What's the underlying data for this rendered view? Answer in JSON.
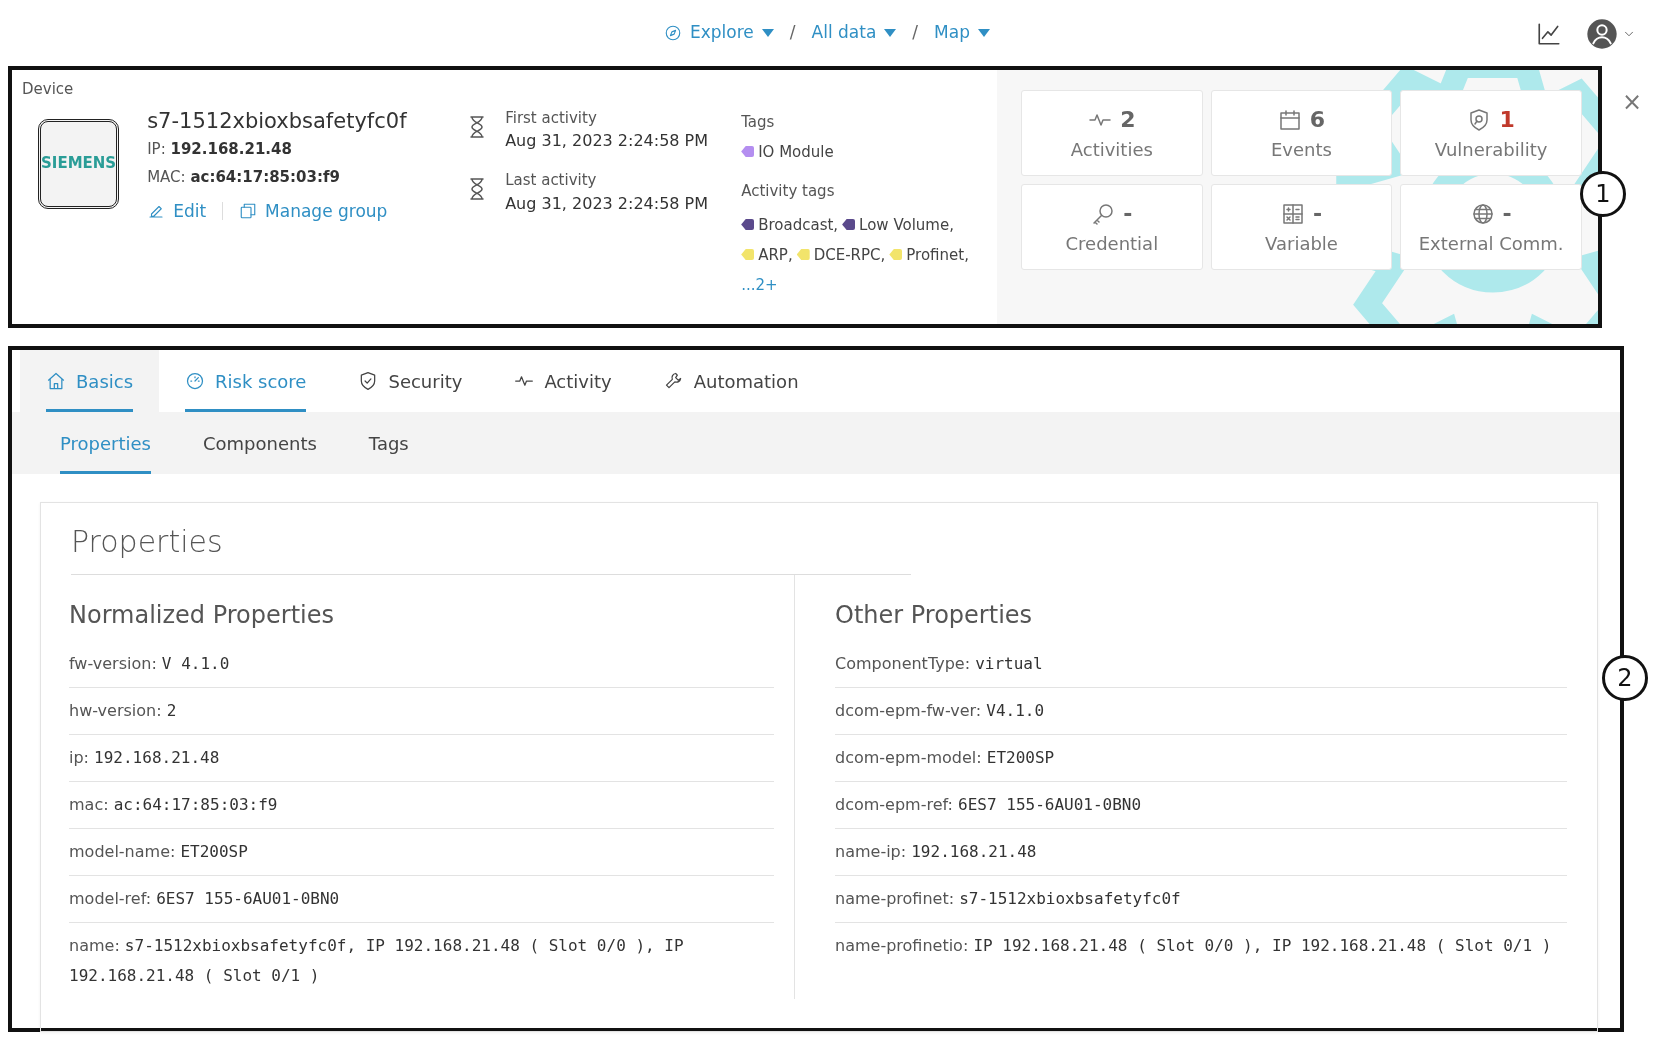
{
  "breadcrumb": [
    {
      "label": "Explore"
    },
    {
      "separator": "/",
      "label": "All data"
    },
    {
      "separator": "/",
      "label": "Map"
    }
  ],
  "close_label": "×",
  "device": {
    "section_label": "Device",
    "logo_text": "SIEMENS",
    "name": "s7-1512xbioxbsafetyfc0f",
    "ip_label": "IP:",
    "ip": "192.168.21.48",
    "mac_label": "MAC:",
    "mac": "ac:64:17:85:03:f9",
    "actions": [
      "Edit",
      "Manage group"
    ],
    "first_activity": {
      "label": "First activity",
      "value": "Aug 31, 2023 2:24:58 PM"
    },
    "last_activity": {
      "label": "Last activity",
      "value": "Aug 31, 2023 2:24:58 PM"
    },
    "tags_label": "Tags",
    "tags": [
      {
        "label": "IO Module",
        "color": "#b48ef0"
      }
    ],
    "activity_tags_label": "Activity tags",
    "activity_tags": [
      {
        "label": "Broadcast,",
        "color": "#5b4a8c"
      },
      {
        "label": "Low Volume,",
        "color": "#5b4a8c"
      },
      {
        "label": "ARP,",
        "color": "#f2e46b"
      },
      {
        "label": "DCE-RPC,",
        "color": "#f2e46b"
      },
      {
        "label": "Profinet,",
        "color": "#f2e46b"
      }
    ],
    "more_tags": "...2+"
  },
  "stats": [
    {
      "count": "2",
      "label": "Activities",
      "alert": false
    },
    {
      "count": "6",
      "label": "Events",
      "alert": false
    },
    {
      "count": "1",
      "label": "Vulnerability",
      "alert": true
    },
    {
      "count": "-",
      "label": "Credential",
      "alert": false
    },
    {
      "count": "-",
      "label": "Variable",
      "alert": false
    },
    {
      "count": "-",
      "label": "External Comm.",
      "alert": false
    }
  ],
  "tabs": [
    {
      "label": "Basics",
      "selected": true,
      "underlined": true
    },
    {
      "label": "Risk score",
      "selected": false,
      "underlined": true
    },
    {
      "label": "Security",
      "selected": false,
      "underlined": false
    },
    {
      "label": "Activity",
      "selected": false,
      "underlined": false
    },
    {
      "label": "Automation",
      "selected": false,
      "underlined": false
    }
  ],
  "subtabs": [
    {
      "label": "Properties",
      "selected": true
    },
    {
      "label": "Components",
      "selected": false
    },
    {
      "label": "Tags",
      "selected": false
    }
  ],
  "properties": {
    "title": "Properties",
    "columns": [
      {
        "heading": "Normalized Properties",
        "rows": [
          {
            "label": "fw-version:",
            "value": "V 4.1.0"
          },
          {
            "label": "hw-version:",
            "value": "2"
          },
          {
            "label": "ip:",
            "value": "192.168.21.48"
          },
          {
            "label": "mac:",
            "value": "ac:64:17:85:03:f9"
          },
          {
            "label": "model-name:",
            "value": "ET200SP"
          },
          {
            "label": "model-ref:",
            "value": "6ES7 155-6AU01-0BN0"
          },
          {
            "label": "name:",
            "value": "s7-1512xbioxbsafetyfc0f, IP 192.168.21.48 ( Slot 0/0 ), IP 192.168.21.48 ( Slot 0/1 )"
          }
        ]
      },
      {
        "heading": "Other Properties",
        "rows": [
          {
            "label": "ComponentType:",
            "value": "virtual"
          },
          {
            "label": "dcom-epm-fw-ver:",
            "value": "V4.1.0"
          },
          {
            "label": "dcom-epm-model:",
            "value": "ET200SP"
          },
          {
            "label": "dcom-epm-ref:",
            "value": "6ES7 155-6AU01-0BN0"
          },
          {
            "label": "name-ip:",
            "value": "192.168.21.48"
          },
          {
            "label": "name-profinet:",
            "value": "s7-1512xbioxbsafetyfc0f"
          },
          {
            "label": "name-profinetio:",
            "value": "IP 192.168.21.48 ( Slot 0/0 ), IP 192.168.21.48 ( Slot 0/1 )"
          }
        ]
      }
    ]
  },
  "callouts": [
    "1",
    "2"
  ]
}
